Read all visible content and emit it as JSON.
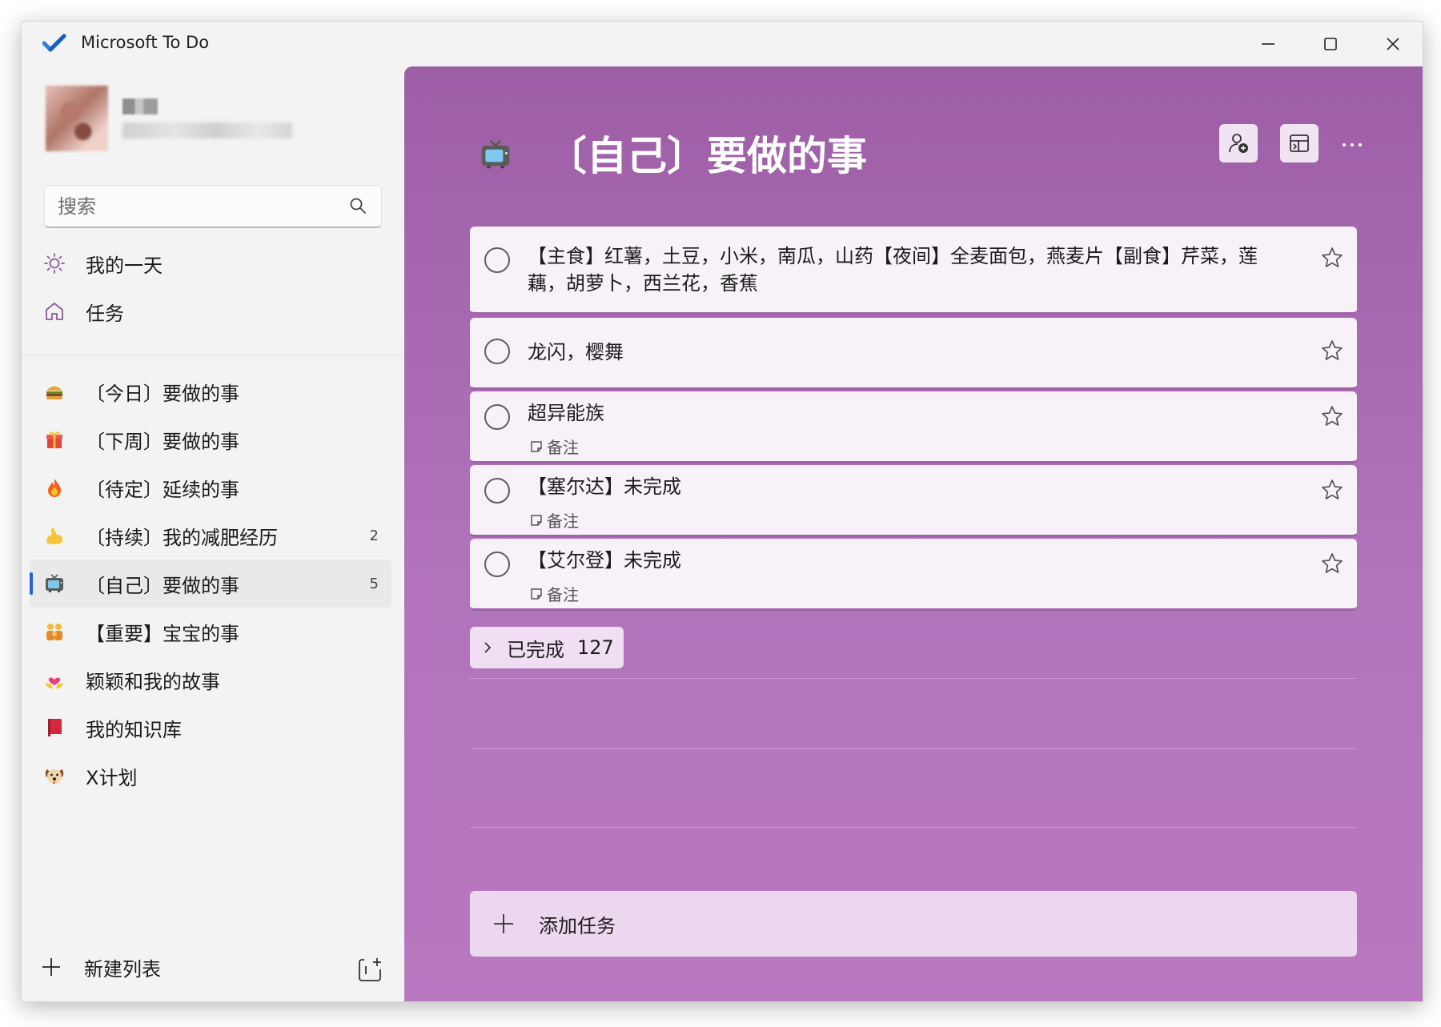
{
  "window": {
    "title": "Microsoft To Do"
  },
  "sidebar": {
    "search": {
      "placeholder": "搜索",
      "value": ""
    },
    "smart_lists": [
      {
        "label": "我的一天",
        "icon": "sun-icon"
      },
      {
        "label": "任务",
        "icon": "home-icon"
      }
    ],
    "lists": [
      {
        "label": "〔今日〕要做的事",
        "icon": "hamburger-icon",
        "count": ""
      },
      {
        "label": "〔下周〕要做的事",
        "icon": "gift-icon",
        "count": ""
      },
      {
        "label": "〔待定〕延续的事",
        "icon": "fire-icon",
        "count": ""
      },
      {
        "label": "〔持续〕我的减肥经历",
        "icon": "flexed-biceps-icon",
        "count": "2"
      },
      {
        "label": "〔自己〕要做的事",
        "icon": "television-icon",
        "count": "5",
        "active": true
      },
      {
        "label": "【重要】宝宝的事",
        "icon": "family-icon",
        "count": ""
      },
      {
        "label": "颖颖和我的故事",
        "icon": "heart-hands-icon",
        "count": ""
      },
      {
        "label": "我的知识库",
        "icon": "red-book-icon",
        "count": ""
      },
      {
        "label": "X计划",
        "icon": "dog-face-icon",
        "count": ""
      }
    ],
    "new_list_label": "新建列表"
  },
  "main": {
    "title": "〔自己〕要做的事",
    "title_icon": "television-icon",
    "accent_color": "#9d5ea6",
    "tasks": [
      {
        "text": "【主食】红薯，土豆，小米，南瓜，山药【夜间】全麦面包，燕麦片【副食】芹菜，莲藕，胡萝卜，西兰花，香蕉",
        "note": ""
      },
      {
        "text": "龙闪，樱舞",
        "note": ""
      },
      {
        "text": "超异能族",
        "note": "备注"
      },
      {
        "text": "【塞尔达】未完成",
        "note": "备注"
      },
      {
        "text": "【艾尔登】未完成",
        "note": "备注"
      }
    ],
    "completed": {
      "label": "已完成",
      "count": "127"
    },
    "add_task_label": "添加任务"
  }
}
